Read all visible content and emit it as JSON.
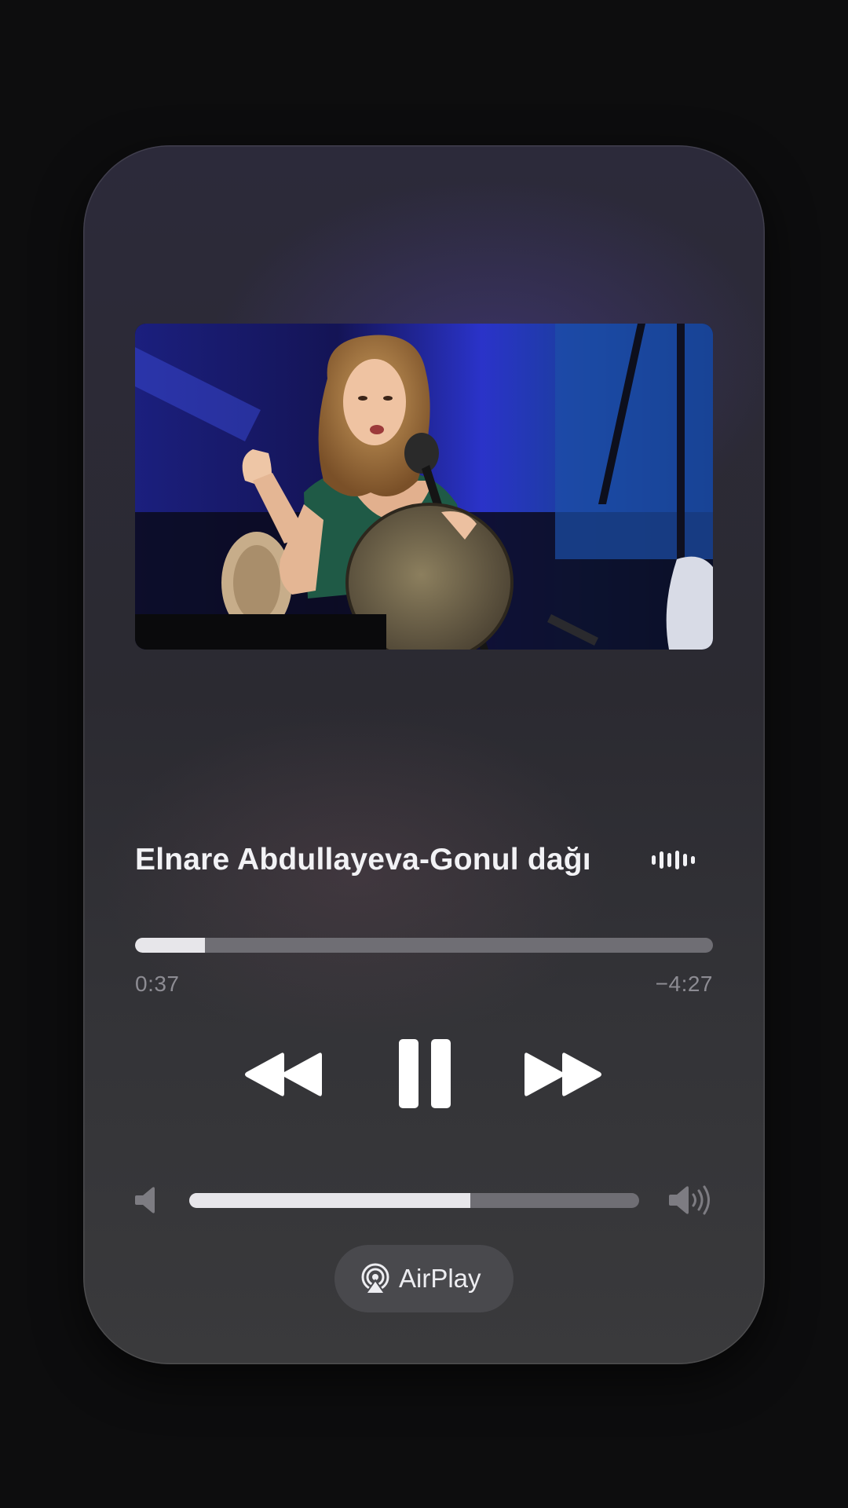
{
  "now_playing": {
    "title": "Elnare Abdullayeva-Gonul dağı",
    "artwork_icon": "video-thumbnail-performer-with-frame-drum",
    "waveform_icon": "audio-waveform-icon"
  },
  "playback": {
    "elapsed": "0:37",
    "remaining": "−4:27",
    "progress_fraction": 0.121,
    "state": "playing"
  },
  "controls": {
    "rewind_icon": "rewind-icon",
    "pause_icon": "pause-icon",
    "fast_forward_icon": "fast-forward-icon"
  },
  "volume": {
    "level_fraction": 0.625,
    "low_icon": "speaker-low-icon",
    "high_icon": "speaker-high-icon"
  },
  "airplay": {
    "label": "AirPlay",
    "icon": "airplay-icon"
  },
  "colors": {
    "background": "#0d0d0e",
    "fill": "#e7e6ea",
    "track": "#6f6e74",
    "secondary_text": "#8d8c93"
  }
}
